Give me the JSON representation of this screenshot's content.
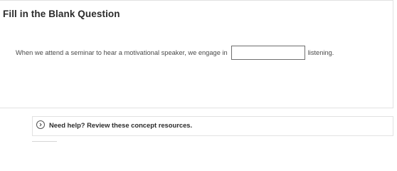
{
  "question": {
    "title": "Fill in the Blank Question",
    "text_before": "When we attend a seminar to hear a motivational speaker, we engage in",
    "blank_value": "",
    "blank_placeholder": "",
    "text_after": "listening."
  },
  "help": {
    "icon": "chevron-right-circle-icon",
    "label": "Need help? Review these concept resources."
  }
}
